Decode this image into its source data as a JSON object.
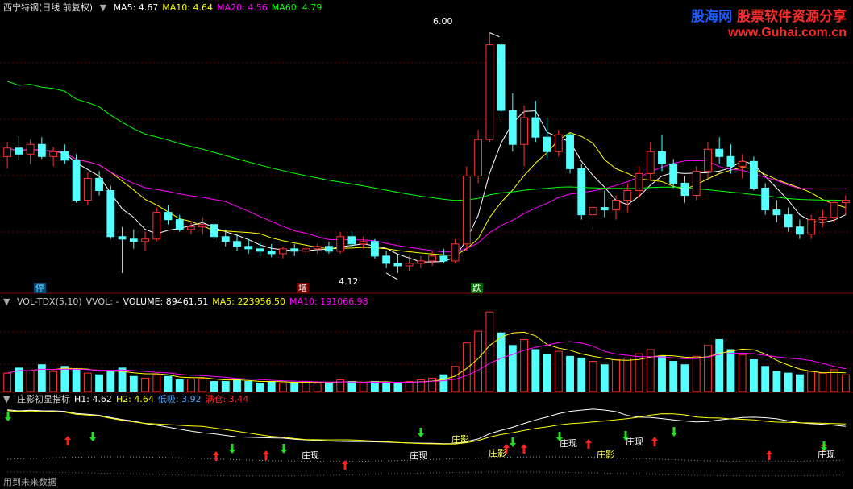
{
  "app": {
    "stock_title": "西宁特钢(日线 前复权)",
    "footer": "用到未来数据"
  },
  "watermark": {
    "brand_cn": "股海网",
    "tagline": "股票软件资源分享",
    "url": "www.Guhai.com.cn"
  },
  "price_panel": {
    "ma_labels": [
      {
        "text": "MA5: 4.67",
        "color": "#ffffff"
      },
      {
        "text": "MA10: 4.64",
        "color": "#ffff00"
      },
      {
        "text": "MA20: 4.56",
        "color": "#ff00ff"
      },
      {
        "text": "MA60: 4.79",
        "color": "#00ff00"
      }
    ],
    "high_label": "6.00",
    "low_label": "4.12",
    "signals": [
      {
        "text": "停",
        "bg": "#004c7a",
        "fg": "#7fdcff"
      },
      {
        "text": "增",
        "bg": "#7a0000",
        "fg": "#ffffff"
      },
      {
        "text": "跌",
        "bg": "#006a00",
        "fg": "#ffffff"
      }
    ]
  },
  "volume_panel": {
    "labels": [
      {
        "text": "VOL-TDX(5,10)",
        "color": "#cccccc"
      },
      {
        "text": "VVOL: -",
        "color": "#cccccc"
      },
      {
        "text": "VOLUME: 89461.51",
        "color": "#ffffff"
      },
      {
        "text": "MA5: 223956.50",
        "color": "#ffff00"
      },
      {
        "text": "MA10: 191066.98",
        "color": "#ff00ff"
      }
    ]
  },
  "indicator_panel": {
    "labels": [
      {
        "text": "庄影初显指标",
        "color": "#cccccc"
      },
      {
        "text": "H1: 4.62",
        "color": "#ffffff"
      },
      {
        "text": "H2: 4.64",
        "color": "#ffff00"
      },
      {
        "text": "低吸: 3.92",
        "color": "#4aa8ff"
      },
      {
        "text": "满仓: 3.44",
        "color": "#ff3030"
      }
    ],
    "text_marks": [
      "庄现",
      "庄现",
      "庄影",
      "庄影",
      "庄现",
      "庄现",
      "庄影",
      "庄现"
    ]
  },
  "colors": {
    "up": "#ff3232",
    "down": "#54ffff",
    "ma5": "#ffffff",
    "ma10": "#ffff00",
    "ma20": "#ff00ff",
    "ma60": "#00ff00",
    "grid": "#6a0000"
  },
  "chart_data": {
    "type": "candlestick",
    "title": "西宁特钢(日线 前复权)",
    "price_range": [
      3.98,
      6.15
    ],
    "candles_ohlc": [
      [
        4.98,
        5.1,
        4.88,
        5.05
      ],
      [
        5.05,
        5.15,
        4.95,
        5.0
      ],
      [
        5.0,
        5.12,
        4.92,
        5.08
      ],
      [
        5.08,
        5.14,
        4.96,
        4.98
      ],
      [
        4.98,
        5.06,
        4.9,
        5.02
      ],
      [
        5.02,
        5.08,
        4.92,
        4.95
      ],
      [
        4.95,
        5.0,
        4.6,
        4.62
      ],
      [
        4.62,
        4.85,
        4.58,
        4.8
      ],
      [
        4.8,
        4.86,
        4.66,
        4.7
      ],
      [
        4.7,
        4.74,
        4.3,
        4.32
      ],
      [
        4.32,
        4.4,
        4.02,
        4.3
      ],
      [
        4.3,
        4.38,
        4.22,
        4.28
      ],
      [
        4.28,
        4.36,
        4.2,
        4.3
      ],
      [
        4.3,
        4.56,
        4.28,
        4.52
      ],
      [
        4.52,
        4.58,
        4.42,
        4.46
      ],
      [
        4.46,
        4.5,
        4.36,
        4.38
      ],
      [
        4.38,
        4.45,
        4.34,
        4.4
      ],
      [
        4.4,
        4.48,
        4.34,
        4.42
      ],
      [
        4.42,
        4.44,
        4.3,
        4.32
      ],
      [
        4.32,
        4.38,
        4.24,
        4.28
      ],
      [
        4.28,
        4.34,
        4.2,
        4.24
      ],
      [
        4.24,
        4.3,
        4.18,
        4.22
      ],
      [
        4.22,
        4.28,
        4.16,
        4.2
      ],
      [
        4.2,
        4.26,
        4.15,
        4.18
      ],
      [
        4.18,
        4.24,
        4.14,
        4.22
      ],
      [
        4.22,
        4.26,
        4.16,
        4.2
      ],
      [
        4.2,
        4.24,
        4.16,
        4.22
      ],
      [
        4.22,
        4.26,
        4.18,
        4.24
      ],
      [
        4.24,
        4.28,
        4.18,
        4.2
      ],
      [
        4.2,
        4.36,
        4.18,
        4.32
      ],
      [
        4.32,
        4.36,
        4.24,
        4.26
      ],
      [
        4.26,
        4.32,
        4.22,
        4.28
      ],
      [
        4.28,
        4.3,
        4.14,
        4.16
      ],
      [
        4.16,
        4.2,
        4.06,
        4.1
      ],
      [
        4.1,
        4.18,
        4.02,
        4.08
      ],
      [
        4.08,
        4.16,
        4.04,
        4.1
      ],
      [
        4.1,
        4.16,
        4.06,
        4.12
      ],
      [
        4.12,
        4.2,
        4.08,
        4.16
      ],
      [
        4.16,
        4.22,
        4.1,
        4.12
      ],
      [
        4.12,
        4.3,
        4.1,
        4.26
      ],
      [
        4.26,
        4.9,
        4.2,
        4.82
      ],
      [
        4.82,
        5.2,
        4.76,
        5.12
      ],
      [
        5.12,
        6.0,
        5.1,
        5.9
      ],
      [
        5.9,
        5.96,
        5.3,
        5.36
      ],
      [
        5.36,
        5.5,
        5.02,
        5.08
      ],
      [
        5.08,
        5.4,
        4.9,
        5.3
      ],
      [
        5.3,
        5.44,
        5.1,
        5.14
      ],
      [
        5.14,
        5.3,
        4.96,
        5.02
      ],
      [
        5.02,
        5.2,
        4.98,
        5.16
      ],
      [
        5.16,
        5.18,
        4.84,
        4.88
      ],
      [
        4.88,
        4.92,
        4.46,
        4.5
      ],
      [
        4.5,
        4.62,
        4.38,
        4.56
      ],
      [
        4.56,
        4.7,
        4.48,
        4.54
      ],
      [
        4.54,
        4.66,
        4.46,
        4.62
      ],
      [
        4.62,
        4.76,
        4.52,
        4.7
      ],
      [
        4.7,
        4.9,
        4.64,
        4.84
      ],
      [
        4.84,
        5.1,
        4.78,
        5.02
      ],
      [
        5.02,
        5.16,
        4.86,
        4.92
      ],
      [
        4.92,
        4.96,
        4.72,
        4.76
      ],
      [
        4.76,
        4.82,
        4.6,
        4.66
      ],
      [
        4.66,
        4.9,
        4.62,
        4.86
      ],
      [
        4.86,
        5.1,
        4.8,
        5.04
      ],
      [
        5.04,
        5.14,
        4.92,
        4.98
      ],
      [
        4.98,
        5.08,
        4.84,
        4.9
      ],
      [
        4.9,
        5.0,
        4.8,
        4.94
      ],
      [
        4.94,
        4.98,
        4.7,
        4.72
      ],
      [
        4.72,
        4.76,
        4.5,
        4.54
      ],
      [
        4.54,
        4.62,
        4.44,
        4.5
      ],
      [
        4.5,
        4.56,
        4.36,
        4.4
      ],
      [
        4.4,
        4.46,
        4.3,
        4.34
      ],
      [
        4.34,
        4.5,
        4.3,
        4.46
      ],
      [
        4.46,
        4.54,
        4.4,
        4.48
      ],
      [
        4.48,
        4.62,
        4.44,
        4.6
      ],
      [
        4.6,
        4.66,
        4.5,
        4.62
      ]
    ],
    "ma_series": [
      {
        "name": "MA5",
        "last": 4.67
      },
      {
        "name": "MA10",
        "last": 4.64
      },
      {
        "name": "MA20",
        "last": 4.56
      },
      {
        "name": "MA60",
        "last": 4.79
      }
    ],
    "volume": {
      "last": 89461.51,
      "ma5_last": 223956.5,
      "ma10_last": 191066.98,
      "values": [
        0.22,
        0.28,
        0.25,
        0.32,
        0.24,
        0.3,
        0.26,
        0.22,
        0.2,
        0.24,
        0.28,
        0.18,
        0.16,
        0.2,
        0.18,
        0.14,
        0.15,
        0.16,
        0.12,
        0.12,
        0.14,
        0.12,
        0.1,
        0.12,
        0.1,
        0.11,
        0.12,
        0.1,
        0.1,
        0.14,
        0.12,
        0.1,
        0.12,
        0.1,
        0.1,
        0.12,
        0.14,
        0.16,
        0.2,
        0.3,
        0.58,
        0.72,
        0.95,
        0.7,
        0.55,
        0.62,
        0.5,
        0.44,
        0.48,
        0.42,
        0.4,
        0.36,
        0.32,
        0.38,
        0.4,
        0.45,
        0.5,
        0.42,
        0.36,
        0.32,
        0.42,
        0.55,
        0.62,
        0.5,
        0.44,
        0.38,
        0.3,
        0.24,
        0.22,
        0.2,
        0.24,
        0.22,
        0.26,
        0.2
      ]
    },
    "indicator": {
      "H1_last": 4.62,
      "H2_last": 4.64,
      "低吸_last": 3.92,
      "满仓_last": 3.44
    }
  }
}
